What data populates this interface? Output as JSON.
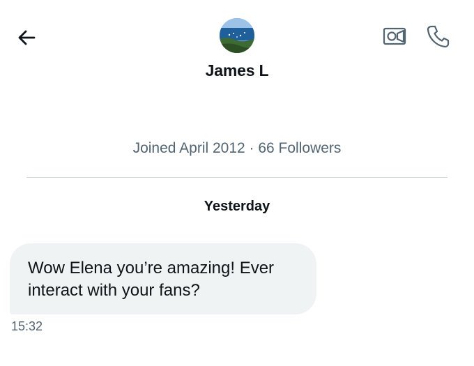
{
  "header": {
    "back_icon": "arrow-left-icon",
    "contact_name": "James L",
    "video_icon": "video-camera-icon",
    "call_icon": "phone-icon"
  },
  "profile": {
    "meta": "Joined April 2012 · 66 Followers"
  },
  "conversation": {
    "date_separator": "Yesterday",
    "messages": [
      {
        "text": "Wow Elena you’re amazing! Ever interact with your fans?",
        "time": "15:32",
        "direction": "incoming"
      }
    ]
  },
  "colors": {
    "text_primary": "#0f1419",
    "text_secondary": "#536471",
    "bubble_incoming": "#eff3f4",
    "divider": "#cfd9de"
  }
}
